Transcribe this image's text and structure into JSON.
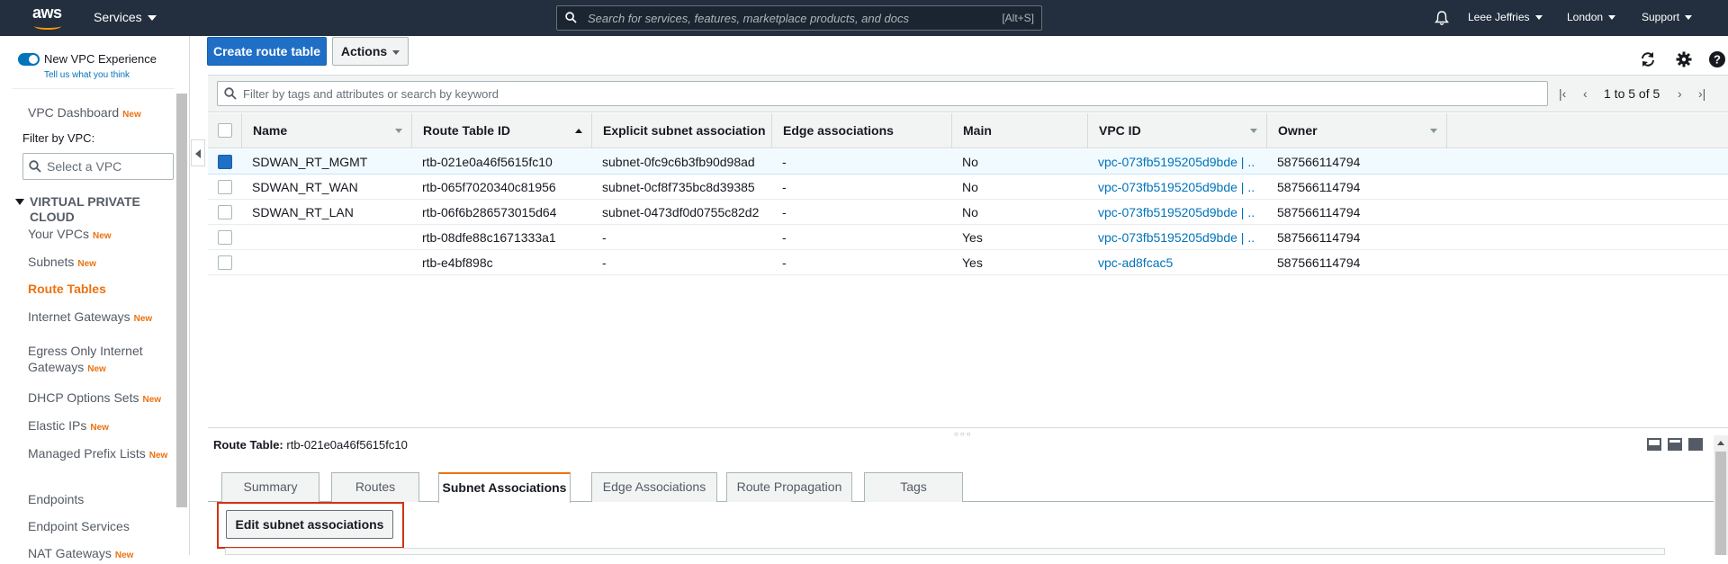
{
  "topnav": {
    "logo_text": "aws",
    "services_label": "Services",
    "search_placeholder": "Search for services, features, marketplace products, and docs",
    "search_shortcut": "[Alt+S]",
    "user_label": "Leee Jeffries",
    "region_label": "London",
    "support_label": "Support"
  },
  "sidebar": {
    "toggle_label": "New VPC Experience",
    "tell_us": "Tell us what you think",
    "dashboard": "VPC Dashboard",
    "new_badge": "New",
    "filter_label": "Filter by VPC:",
    "vpc_placeholder": "Select a VPC",
    "section_title": "VIRTUAL PRIVATE CLOUD",
    "items": [
      {
        "label": "Your VPCs",
        "new": "New"
      },
      {
        "label": "Subnets",
        "new": "New"
      },
      {
        "label": "Route Tables",
        "new": ""
      },
      {
        "label": "Internet Gateways",
        "new": "New"
      },
      {
        "label": "Egress Only Internet Gateways",
        "new": "New"
      },
      {
        "label": "DHCP Options Sets",
        "new": "New"
      },
      {
        "label": "Elastic IPs",
        "new": "New"
      },
      {
        "label": "Managed Prefix Lists",
        "new": "New"
      },
      {
        "label": "Endpoints",
        "new": ""
      },
      {
        "label": "Endpoint Services",
        "new": ""
      },
      {
        "label": "NAT Gateways",
        "new": "New"
      }
    ]
  },
  "toolbar": {
    "create_label": "Create route table",
    "actions_label": "Actions",
    "icons": [
      "refresh-icon",
      "gear-icon",
      "help-icon"
    ]
  },
  "filter": {
    "placeholder": "Filter by tags and attributes or search by keyword",
    "page_info": "1 to 5 of 5"
  },
  "table": {
    "columns": [
      "Name",
      "Route Table ID",
      "Explicit subnet association",
      "Edge associations",
      "Main",
      "VPC ID",
      "Owner"
    ],
    "rows": [
      {
        "name": "SDWAN_RT_MGMT",
        "id": "rtb-021e0a46f5615fc10",
        "subnet": "subnet-0fc9c6b3fb90d98ad",
        "edge": "-",
        "main": "No",
        "vpc": "vpc-073fb5195205d9bde | ...",
        "owner": "587566114794",
        "selected": true
      },
      {
        "name": "SDWAN_RT_WAN",
        "id": "rtb-065f7020340c81956",
        "subnet": "subnet-0cf8f735bc8d39385",
        "edge": "-",
        "main": "No",
        "vpc": "vpc-073fb5195205d9bde | ...",
        "owner": "587566114794",
        "selected": false
      },
      {
        "name": "SDWAN_RT_LAN",
        "id": "rtb-06f6b286573015d64",
        "subnet": "subnet-0473df0d0755c82d2",
        "edge": "-",
        "main": "No",
        "vpc": "vpc-073fb5195205d9bde | ...",
        "owner": "587566114794",
        "selected": false
      },
      {
        "name": "",
        "id": "rtb-08dfe88c1671333a1",
        "subnet": "-",
        "edge": "-",
        "main": "Yes",
        "vpc": "vpc-073fb5195205d9bde | ...",
        "owner": "587566114794",
        "selected": false
      },
      {
        "name": "",
        "id": "rtb-e4bf898c",
        "subnet": "-",
        "edge": "-",
        "main": "Yes",
        "vpc": "vpc-ad8fcac5",
        "owner": "587566114794",
        "selected": false
      }
    ]
  },
  "detail": {
    "label": "Route Table:",
    "value": "rtb-021e0a46f5615fc10",
    "tabs": [
      "Summary",
      "Routes",
      "Subnet Associations",
      "Edge Associations",
      "Route Propagation",
      "Tags"
    ],
    "active_tab": "Subnet Associations",
    "edit_button": "Edit subnet associations"
  },
  "colors": {
    "nav_bg": "#232f3e",
    "primary": "#1f6fc6",
    "accent": "#ec7211",
    "link": "#0073bb",
    "highlight": "#d13212"
  }
}
